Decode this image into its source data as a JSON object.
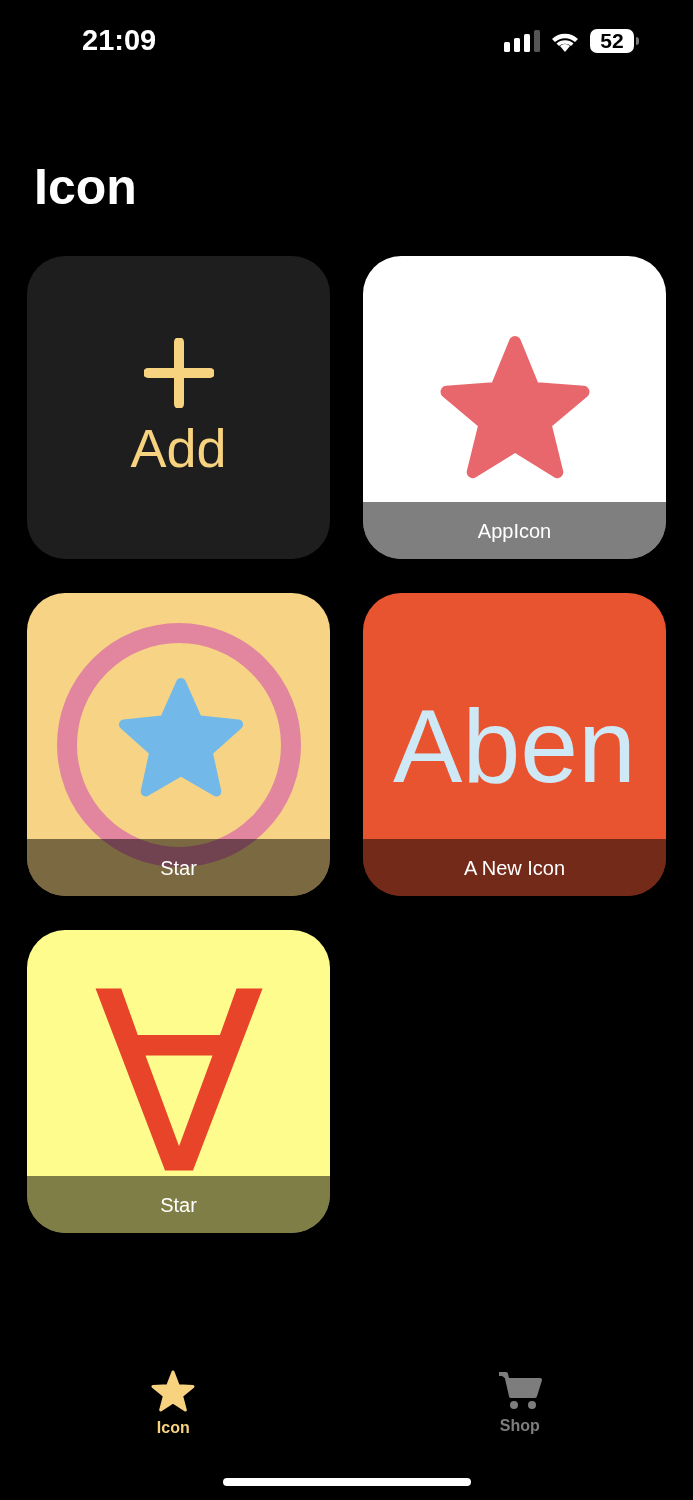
{
  "status_bar": {
    "time": "21:09",
    "battery": "52"
  },
  "title": "Icon",
  "tiles": [
    {
      "kind": "add",
      "label": "Add"
    },
    {
      "kind": "star",
      "color": "#ffffff",
      "label": "AppIcon"
    },
    {
      "kind": "ring-star",
      "color": "#f6d385",
      "label": "Star"
    },
    {
      "kind": "text",
      "color": "#e95430",
      "art_text": "Aben",
      "label": "A New Icon"
    },
    {
      "kind": "flipped-text",
      "color": "#fefc8d",
      "art_text": "A",
      "label": "Star"
    }
  ],
  "tabs": [
    {
      "label": "Icon",
      "selected": true
    },
    {
      "label": "Shop",
      "selected": false
    }
  ]
}
